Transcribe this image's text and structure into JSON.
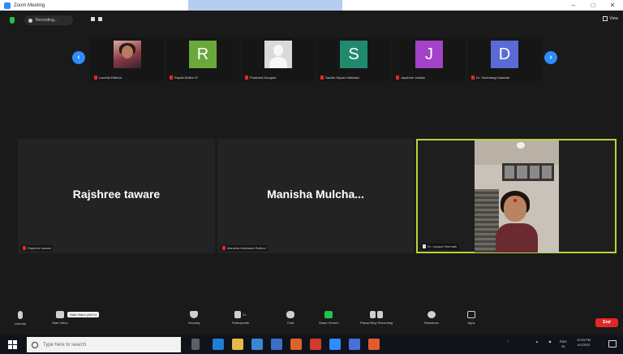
{
  "window": {
    "title": "Zoom Meeting",
    "controls": [
      "–",
      "□",
      "✕"
    ]
  },
  "topbar": {
    "recording_label": "Recording...",
    "view_label": "View"
  },
  "strip": {
    "participants": [
      {
        "name": "Lacchia Rathod",
        "avatar_type": "photo"
      },
      {
        "name": "Rupali Dhillon R",
        "avatar_type": "initial",
        "initial": "R",
        "color": "#6aa83a"
      },
      {
        "name": "Prashant Dongare",
        "avatar_type": "silhouette"
      },
      {
        "name": "Sachin Sopan Gaikwad",
        "avatar_type": "initial",
        "initial": "S",
        "color": "#1f8a6e"
      },
      {
        "name": "Jayshree Jadhav",
        "avatar_type": "initial",
        "initial": "J",
        "color": "#a243c8"
      },
      {
        "name": "Dr. Shubhangi Inamdar",
        "avatar_type": "initial",
        "initial": "D",
        "color": "#5a6ad6"
      }
    ]
  },
  "gallery": {
    "tiles": [
      {
        "display_name": "Rajshree taware",
        "label": "Rajshree taware"
      },
      {
        "display_name": "Manisha  Mulcha...",
        "label": "Manisha Mulchand Rathod"
      },
      {
        "display_name": "",
        "label": "Dr. Jayaya Hiremath"
      }
    ],
    "active_border_color": "#b8d43c"
  },
  "toolbar": {
    "unmute": "Unmute",
    "start_video": "Start Video",
    "tooltip": "Start Video (Alt+V)",
    "security": "Security",
    "participants": "Participants",
    "participants_count": "21",
    "chat": "Chat",
    "share_screen": "Share Screen",
    "pause_recording": "Pause/Stop Recording",
    "reactions": "Reactions",
    "apps": "Apps",
    "end": "End"
  },
  "taskbar": {
    "search_placeholder": "Type here to search",
    "language": "ENG",
    "region": "IN",
    "time": "12:03 PM",
    "date": "4/1/2022"
  }
}
